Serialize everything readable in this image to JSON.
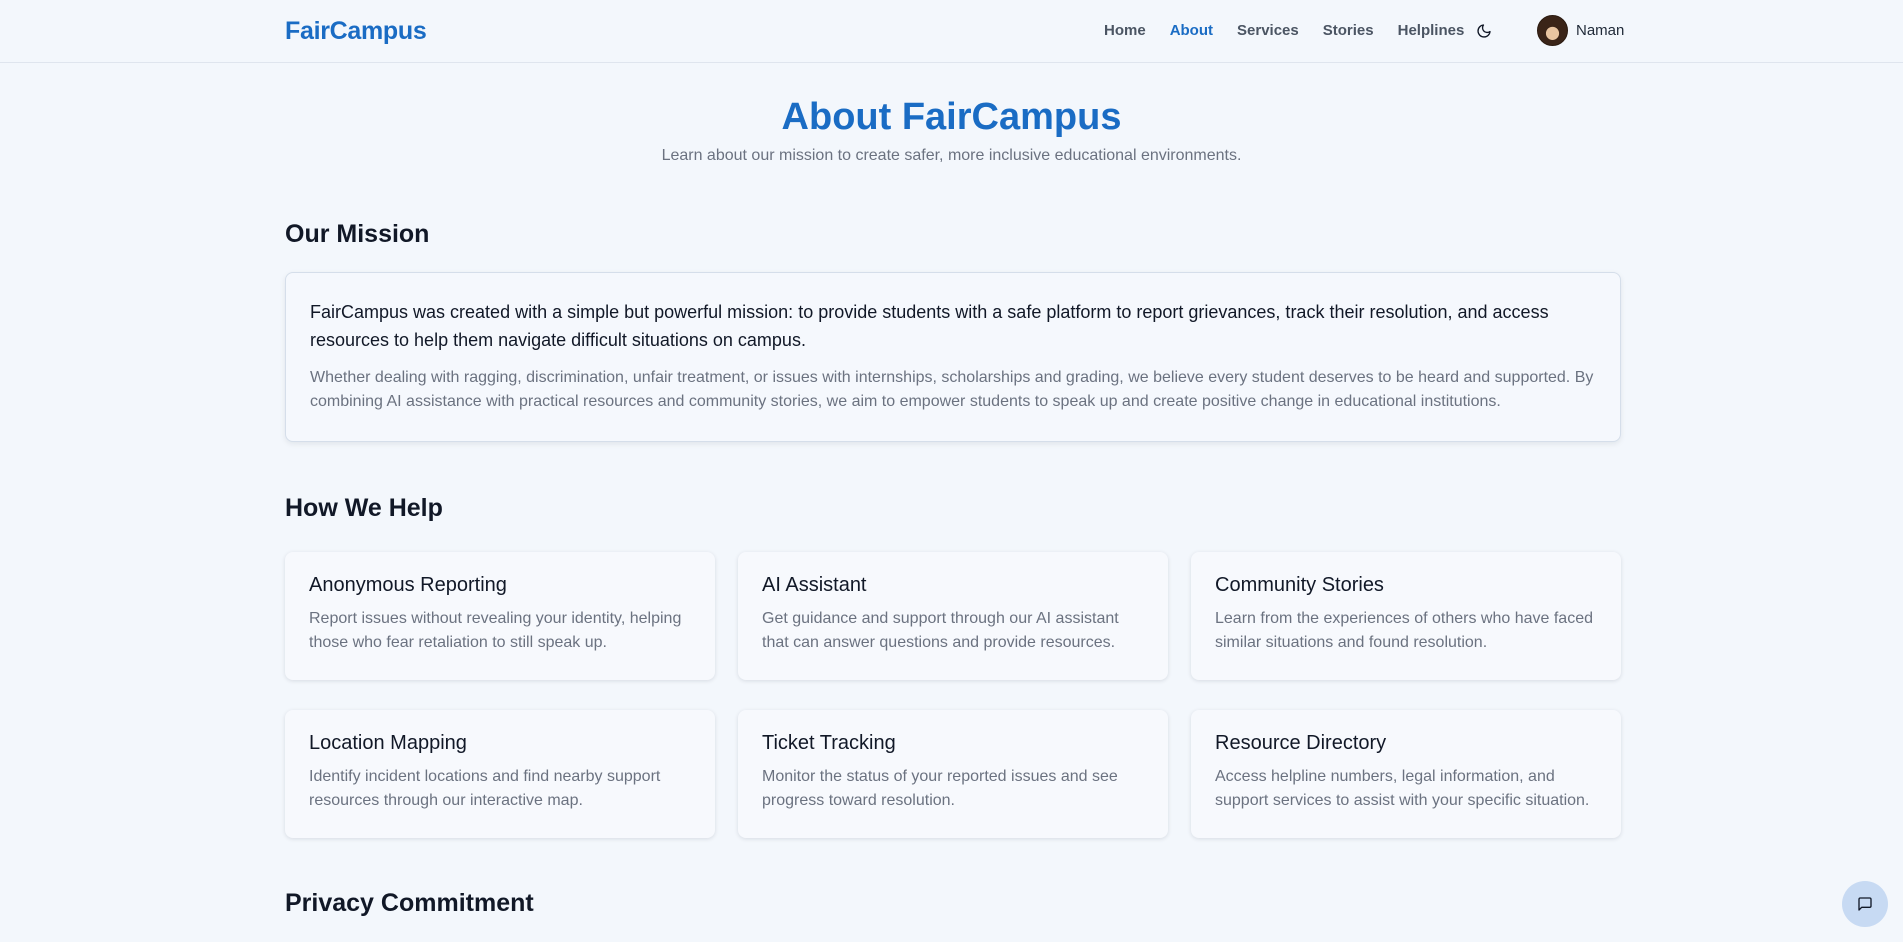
{
  "header": {
    "brand": "FairCampus",
    "nav": [
      {
        "label": "Home",
        "active": false
      },
      {
        "label": "About",
        "active": true
      },
      {
        "label": "Services",
        "active": false
      },
      {
        "label": "Stories",
        "active": false
      },
      {
        "label": "Helplines",
        "active": false
      }
    ],
    "theme_icon": "moon-icon",
    "user_name": "Naman"
  },
  "hero": {
    "title": "About FairCampus",
    "subtitle": "Learn about our mission to create safer, more inclusive educational environments."
  },
  "mission": {
    "heading": "Our Mission",
    "lead": "FairCampus was created with a simple but powerful mission: to provide students with a safe platform to report grievances, track their resolution, and access resources to help them navigate difficult situations on campus.",
    "body": "Whether dealing with ragging, discrimination, unfair treatment, or issues with internships, scholarships and grading, we believe every student deserves to be heard and supported. By combining AI assistance with practical resources and community stories, we aim to empower students to speak up and create positive change in educational institutions."
  },
  "help": {
    "heading": "How We Help",
    "cards": [
      {
        "title": "Anonymous Reporting",
        "desc": "Report issues without revealing your identity, helping those who fear retaliation to still speak up."
      },
      {
        "title": "AI Assistant",
        "desc": "Get guidance and support through our AI assistant that can answer questions and provide resources."
      },
      {
        "title": "Community Stories",
        "desc": "Learn from the experiences of others who have faced similar situations and found resolution."
      },
      {
        "title": "Location Mapping",
        "desc": "Identify incident locations and find nearby support resources through our interactive map."
      },
      {
        "title": "Ticket Tracking",
        "desc": "Monitor the status of your reported issues and see progress toward resolution."
      },
      {
        "title": "Resource Directory",
        "desc": "Access helpline numbers, legal information, and support services to assist with your specific situation."
      }
    ]
  },
  "privacy": {
    "heading": "Privacy Commitment"
  },
  "chat_icon": "chat-bubble-icon",
  "colors": {
    "brand": "#1a6cc4",
    "background": "#f3f7fc",
    "chat_button": "#c7daf3"
  }
}
